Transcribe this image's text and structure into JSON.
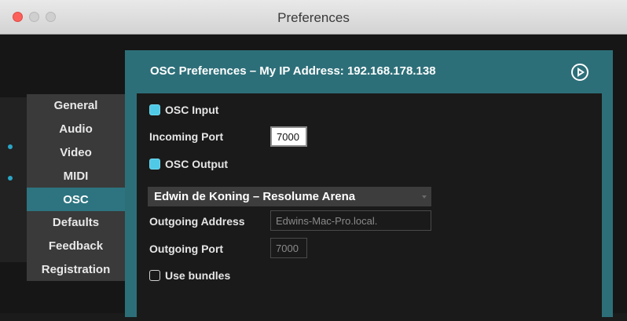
{
  "window": {
    "title": "Preferences"
  },
  "sidebar": {
    "items": [
      {
        "label": "General"
      },
      {
        "label": "Audio"
      },
      {
        "label": "Video"
      },
      {
        "label": "MIDI"
      },
      {
        "label": "OSC"
      },
      {
        "label": "Defaults"
      },
      {
        "label": "Feedback"
      },
      {
        "label": "Registration"
      }
    ],
    "active": "OSC"
  },
  "panel": {
    "title": "OSC Preferences – My IP Address: 192.168.178.138",
    "osc_input": {
      "label": "OSC Input",
      "checked": true
    },
    "incoming_port": {
      "label": "Incoming Port",
      "value": "7000"
    },
    "osc_output": {
      "label": "OSC Output",
      "checked": true
    },
    "output_target": {
      "value": "Edwin de Koning – Resolume Arena"
    },
    "outgoing_address": {
      "label": "Outgoing Address",
      "value": "Edwins-Mac-Pro.local."
    },
    "outgoing_port": {
      "label": "Outgoing Port",
      "value": "7000"
    },
    "use_bundles": {
      "label": "Use bundles",
      "checked": false
    }
  },
  "colors": {
    "accent": "#2d6f79",
    "checkbox": "#4fc9e6",
    "close": "#fc605b"
  }
}
